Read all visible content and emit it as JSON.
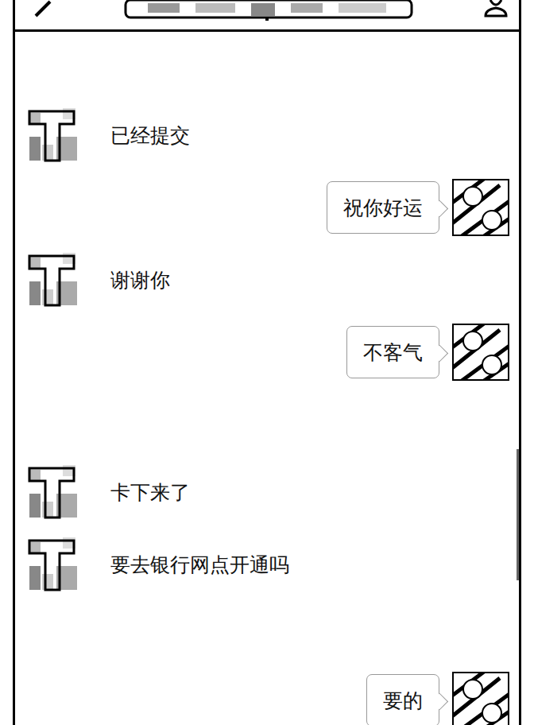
{
  "messages": [
    {
      "text": "已经提交",
      "kind": "received"
    },
    {
      "text": "祝你好运",
      "kind": "sent"
    },
    {
      "text": "谢谢你",
      "kind": "received"
    },
    {
      "text": "不客气",
      "kind": "sent"
    },
    {
      "text": "卡下来了",
      "kind": "received"
    },
    {
      "text": "要去银行网点开通吗",
      "kind": "received"
    },
    {
      "text": "要的",
      "kind": "sent"
    }
  ]
}
